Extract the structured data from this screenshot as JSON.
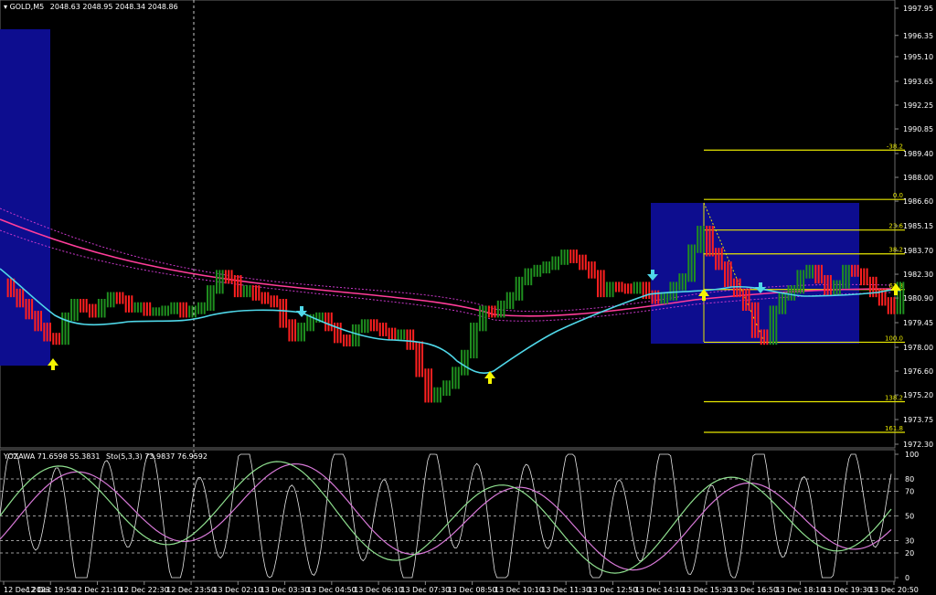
{
  "header": {
    "symbol": "GOLD,M5",
    "ohlc": "2048.63 2048.95 2048.34 2048.86",
    "indicator": "YOZAWA 71.6598 55.3831",
    "stochastic": "Sto(5,3,3) 73.9837 76.9592"
  },
  "colors": {
    "background": "#000000",
    "bull": "#1f8f1f",
    "bear": "#ff2020",
    "ma_fast": "#4fd7e8",
    "ma_slow": "#ff3d9a",
    "envelope": "#c837c8",
    "zone": "#0d0d8f",
    "fib": "#e8e800",
    "arrow_up": "#f5f500",
    "arrow_down": "#4fd7e8"
  },
  "chart_data": {
    "type": "candlestick",
    "price_axis": [
      "1997.95",
      "1996.35",
      "1995.10",
      "1993.65",
      "1992.25",
      "1990.85",
      "1989.40",
      "1988.00",
      "1986.60",
      "1985.15",
      "1983.70",
      "1982.30",
      "1980.90",
      "1979.45",
      "1978.00",
      "1976.60",
      "1975.20",
      "1973.75",
      "1972.30"
    ],
    "time_axis": [
      "12 Dec 2023",
      "12 Dec 19:50",
      "12 Dec 21:10",
      "12 Dec 22:30",
      "12 Dec 23:50",
      "13 Dec 02:10",
      "13 Dec 03:30",
      "13 Dec 04:50",
      "13 Dec 06:10",
      "13 Dec 07:30",
      "13 Dec 08:50",
      "13 Dec 10:10",
      "13 Dec 11:30",
      "13 Dec 12:50",
      "13 Dec 14:10",
      "13 Dec 15:30",
      "13 Dec 16:50",
      "13 Dec 18:10",
      "13 Dec 19:30",
      "13 Dec 20:50"
    ],
    "fib_levels": [
      "-38.2",
      "0.0",
      "23.6",
      "38.2",
      "61.8",
      "100.0",
      "138.2",
      "161.8"
    ],
    "fib_prices": [
      1989.6,
      1986.7,
      1984.9,
      1983.5,
      1981.4,
      1978.3,
      1974.8,
      1973.0
    ],
    "osc_axis": [
      "100",
      "80",
      "70",
      "50",
      "30",
      "20",
      "0"
    ],
    "osc_levels": [
      100,
      80,
      70,
      50,
      30,
      20,
      0
    ],
    "close_approx": [
      1981.8,
      1981.2,
      1980.6,
      1979.9,
      1979.2,
      1978.6,
      1978.4,
      1979.8,
      1980.6,
      1980.3,
      1980.0,
      1980.6,
      1981.0,
      1980.8,
      1980.3,
      1980.4,
      1980.1,
      1980.1,
      1980.2,
      1980.4,
      1980.0,
      1980.2,
      1980.4,
      1981.4,
      1982.3,
      1982.0,
      1981.2,
      1981.4,
      1981.0,
      1980.8,
      1980.6,
      1979.4,
      1978.6,
      1979.2,
      1979.7,
      1979.8,
      1979.2,
      1978.5,
      1978.3,
      1979.1,
      1979.4,
      1979.2,
      1978.9,
      1978.7,
      1978.8,
      1978.1,
      1976.5,
      1975.0,
      1975.4,
      1975.8,
      1976.6,
      1977.6,
      1979.2,
      1980.2,
      1980.0,
      1980.5,
      1981.0,
      1981.9,
      1982.4,
      1982.6,
      1982.8,
      1983.1,
      1983.5,
      1983.2,
      1982.8,
      1982.3,
      1981.2,
      1981.6,
      1981.5,
      1981.4,
      1981.6,
      1981.1,
      1980.8,
      1981.0,
      1981.6,
      1982.1,
      1983.8,
      1984.9,
      1983.6,
      1982.8,
      1981.8,
      1981.2,
      1980.4,
      1978.8,
      1978.4,
      1980.2,
      1981.0,
      1981.4,
      1982.3,
      1982.6,
      1982.0,
      1981.3,
      1981.7,
      1982.6,
      1982.4,
      1981.9,
      1981.2,
      1980.7,
      1980.2,
      1981.6
    ]
  }
}
